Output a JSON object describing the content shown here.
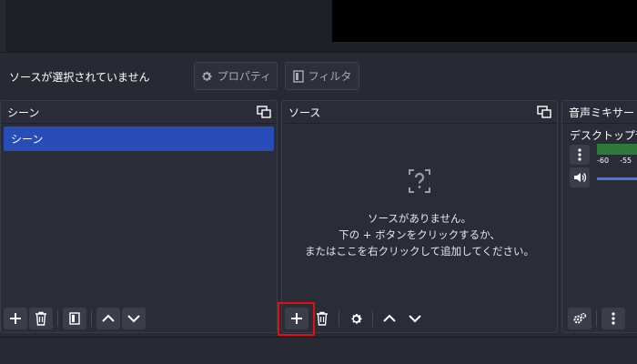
{
  "context_bar": {
    "no_source_label": "ソースが選択されていません",
    "properties_label": "プロパティ",
    "filters_label": "フィルタ"
  },
  "scenes": {
    "title": "シーン",
    "items": [
      {
        "label": "シーン",
        "selected": true
      }
    ]
  },
  "sources": {
    "title": "ソース",
    "empty_lines": [
      "ソースがありません。",
      "下の + ボタンをクリックするか、",
      "またはここを右クリックして追加してください。"
    ]
  },
  "mixer": {
    "title": "音声ミキサー",
    "track_name": "デスクトップ音声",
    "meter_ticks": [
      "-60",
      "-55"
    ]
  },
  "colors": {
    "selected_scene": "#284cb8",
    "highlight": "#e01010",
    "meter_green": "#2f7a3a",
    "fader_blue": "#4a78d8"
  },
  "icons": {
    "properties": "gear-icon",
    "filters": "filter-icon",
    "float": "float-dock-icon",
    "add": "plus-icon",
    "remove": "trash-icon",
    "source_properties": "gear-icon",
    "move_up": "chevron-up-icon",
    "move_down": "chevron-down-icon",
    "empty_sources": "question-icon",
    "mixer_menu": "vertical-dots-icon",
    "mute": "speaker-icon",
    "advanced_audio": "gears-icon"
  }
}
